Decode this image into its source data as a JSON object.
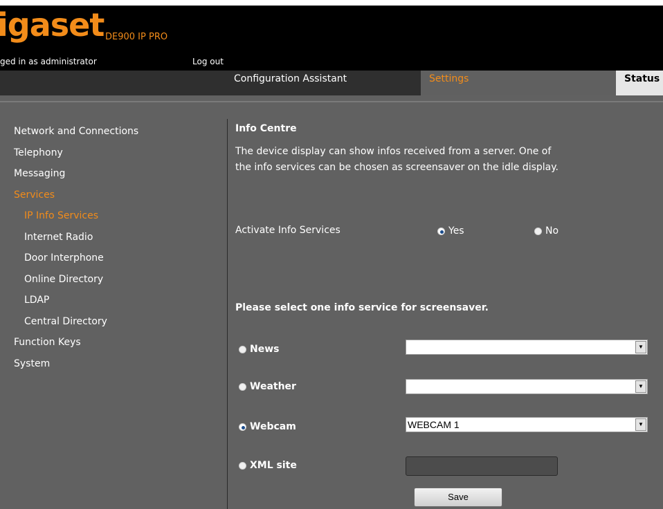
{
  "header": {
    "logo_text": "igaset",
    "model": "DE900 IP PRO",
    "login_status": "ged in as administrator",
    "logout_label": "Log out"
  },
  "tabs": [
    {
      "label": "Configuration Assistant",
      "active": false
    },
    {
      "label": "Settings",
      "active": true
    },
    {
      "label": "Status",
      "active": false
    }
  ],
  "sidebar": {
    "items": [
      {
        "label": "Network and Connections"
      },
      {
        "label": "Telephony"
      },
      {
        "label": "Messaging"
      },
      {
        "label": "Services",
        "active": true
      },
      {
        "label": "IP Info Services",
        "active": true,
        "sub": true
      },
      {
        "label": "Internet Radio",
        "sub": true
      },
      {
        "label": "Door Interphone",
        "sub": true
      },
      {
        "label": "Online Directory",
        "sub": true
      },
      {
        "label": "LDAP",
        "sub": true
      },
      {
        "label": "Central Directory",
        "sub": true
      },
      {
        "label": "Function Keys"
      },
      {
        "label": "System"
      }
    ]
  },
  "content": {
    "title": "Info Centre",
    "description": "The device display can show infos received from a server. One of the info services can be chosen as screensaver on the idle display.",
    "activate": {
      "label": "Activate Info Services",
      "options": [
        {
          "label": "Yes",
          "checked": true
        },
        {
          "label": "No",
          "checked": false
        }
      ]
    },
    "screensaver": {
      "title": "Please select one info service for screensaver.",
      "services": [
        {
          "label": "News",
          "checked": false,
          "value": ""
        },
        {
          "label": "Weather",
          "checked": false,
          "value": ""
        },
        {
          "label": "Webcam",
          "checked": true,
          "value": "WEBCAM 1"
        },
        {
          "label": "XML site",
          "checked": false,
          "value": ""
        }
      ]
    },
    "save_label": "Save"
  },
  "colors": {
    "accent": "#f28c1a",
    "content_bg": "#616161",
    "header_bg": "#000000",
    "tabbar_bg": "#2f2f2f"
  }
}
